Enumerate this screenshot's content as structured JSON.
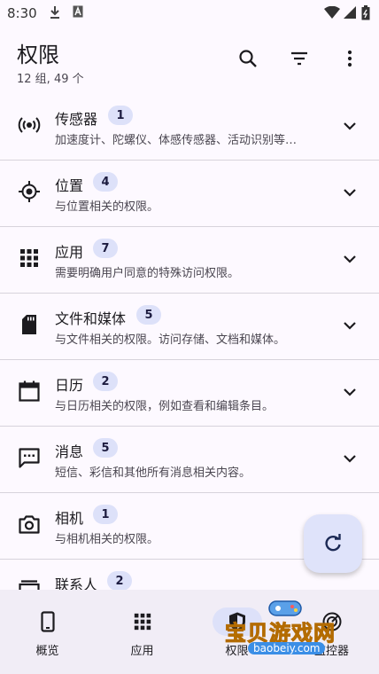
{
  "status": {
    "time": "8:30"
  },
  "header": {
    "title": "权限",
    "subtitle": "12 组, 49 个"
  },
  "groups": [
    {
      "name": "传感器",
      "count": "1",
      "desc": "加速度计、陀螺仪、体感传感器、活动识别等…",
      "icon": "sensors-icon"
    },
    {
      "name": "位置",
      "count": "4",
      "desc": "与位置相关的权限。",
      "icon": "location-icon"
    },
    {
      "name": "应用",
      "count": "7",
      "desc": "需要明确用户同意的特殊访问权限。",
      "icon": "apps-icon"
    },
    {
      "name": "文件和媒体",
      "count": "5",
      "desc": "与文件相关的权限。访问存储、文档和媒体。",
      "icon": "sd-card-icon"
    },
    {
      "name": "日历",
      "count": "2",
      "desc": "与日历相关的权限，例如查看和编辑条目。",
      "icon": "calendar-icon"
    },
    {
      "name": "消息",
      "count": "5",
      "desc": "短信、彩信和其他所有消息相关内容。",
      "icon": "message-icon"
    },
    {
      "name": "相机",
      "count": "1",
      "desc": "与相机相关的权限。",
      "icon": "camera-icon"
    },
    {
      "name": "联系人",
      "count": "2",
      "desc": "",
      "icon": "contacts-icon"
    }
  ],
  "nav": [
    {
      "label": "概览",
      "icon": "phone-icon"
    },
    {
      "label": "应用",
      "icon": "apps-icon"
    },
    {
      "label": "权限",
      "icon": "shield-icon"
    },
    {
      "label": "监控器",
      "icon": "radar-icon"
    }
  ],
  "watermark": {
    "text": "宝贝游戏网",
    "url": "baobeiy.com"
  },
  "colors": {
    "background": "#fdf9ff",
    "badge": "#dde1f9",
    "navbar": "#f1edf6",
    "fab": "#dfe3fa"
  }
}
